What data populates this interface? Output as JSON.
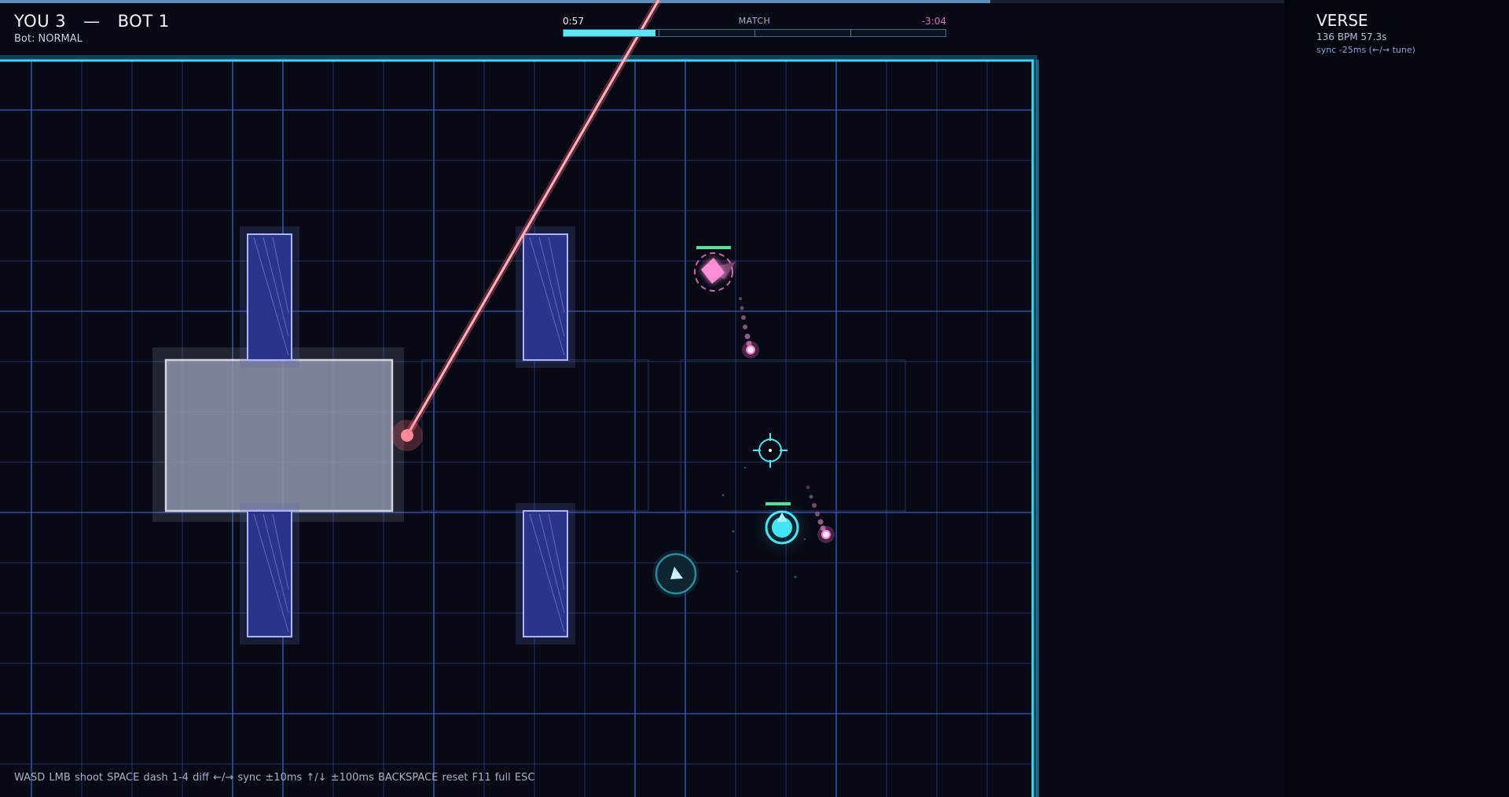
{
  "match_progress": 0.656,
  "score": {
    "you_label": "YOU 3",
    "separator": "—",
    "bot_label": "BOT 1"
  },
  "bot_difficulty": "Bot:  NORMAL",
  "timer": {
    "elapsed": "0:57",
    "label": "MATCH",
    "remaining": "-3:04",
    "progress": 0.24
  },
  "music": {
    "section": "VERSE",
    "bpm_time": "136 BPM   57.3s",
    "sync": "sync -25ms  (←/→ tune)"
  },
  "controls_hint": "WASD  LMB shoot  SPACE dash  1-4 diff  ←/→ sync ±10ms  ↑/↓ ±100ms  BACKSPACE reset  F11 full  ESC",
  "entities": {
    "player_health": 1.0,
    "bot_health": 1.0
  },
  "colors": {
    "grid": "#3e63d8",
    "arena_border": "#37c4ee",
    "player": "#43e5f5",
    "bot": "#ff7ad1",
    "laser": "#ff6b7d",
    "obstacle": "#2a3489",
    "center_block": "#8c90a6",
    "health": "#4fe39a"
  },
  "icons": {
    "player": "player-ship-icon",
    "bot": "bot-ship-icon",
    "crosshair": "crosshair-icon",
    "dash_pickup": "dash-pickup-icon"
  }
}
